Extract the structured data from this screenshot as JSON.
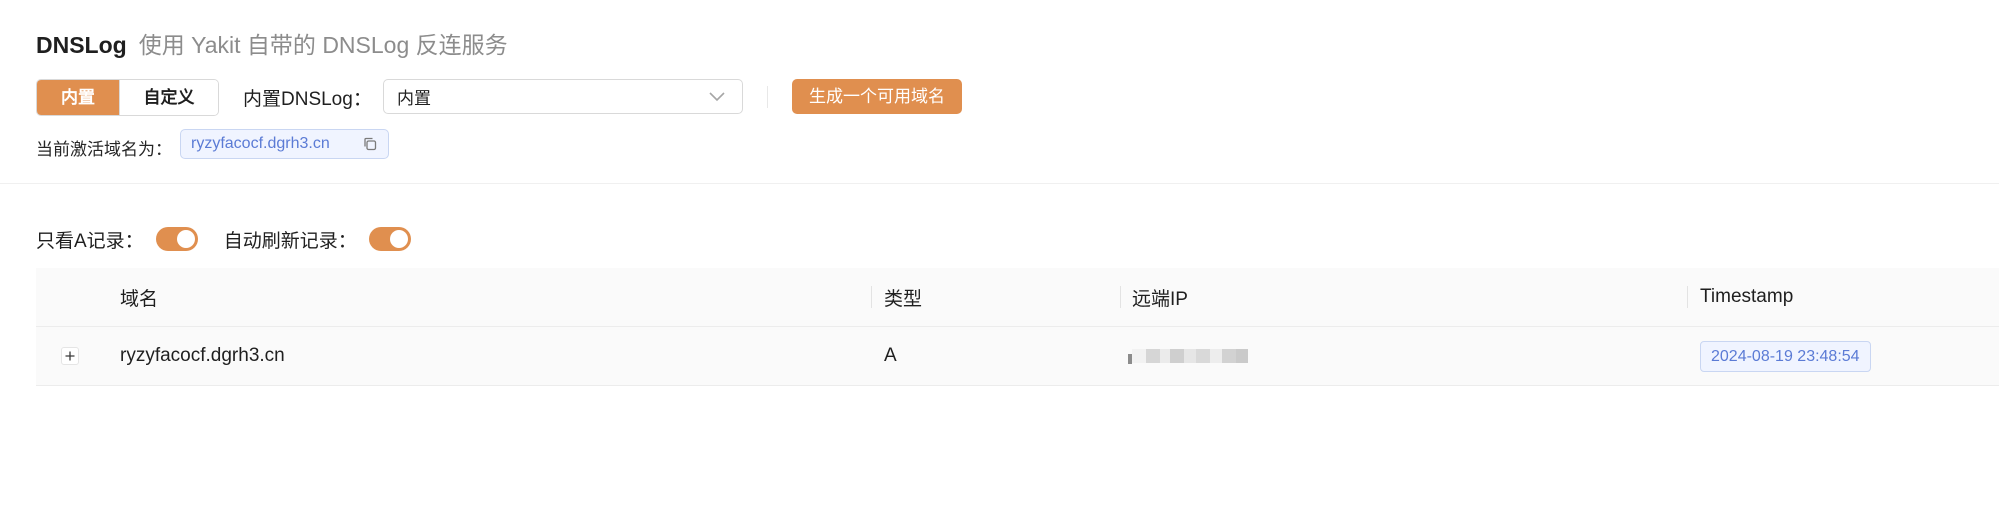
{
  "header": {
    "title": "DNSLog",
    "subtitle": "使用 Yakit 自带的 DNSLog 反连服务"
  },
  "mode": {
    "options": [
      "内置",
      "自定义"
    ],
    "selected": "内置"
  },
  "dnslog_select": {
    "label": "内置DNSLog：",
    "value": "内置",
    "icon": "chevron-down-icon"
  },
  "generate_button": "生成一个可用域名",
  "active_domain": {
    "label": "当前激活域名为：",
    "value": "ryzyfacocf.dgrh3.cn",
    "icon": "copy-icon"
  },
  "filters": {
    "only_a_label": "只看A记录：",
    "only_a_on": true,
    "auto_refresh_label": "自动刷新记录：",
    "auto_refresh_on": true
  },
  "table": {
    "columns": [
      "域名",
      "类型",
      "远端IP",
      "Timestamp"
    ],
    "rows": [
      {
        "domain": "ryzyfacocf.dgrh3.cn",
        "type": "A",
        "remote_ip": "",
        "timestamp": "2024-08-19 23:48:54"
      }
    ]
  },
  "colors": {
    "accent": "#e08f4f",
    "tag_text": "#5b7bd5",
    "tag_bg": "#f0f4ff"
  }
}
